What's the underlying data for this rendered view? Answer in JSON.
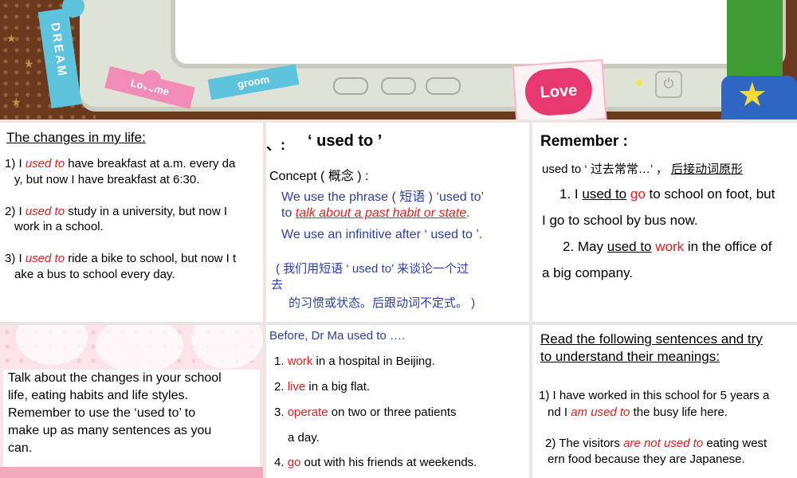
{
  "banner": {
    "sticker_dream": "DREAM",
    "sticker_loveme": "Loveme",
    "sticker_groom": "groom",
    "love_card": "Love"
  },
  "panel1": {
    "title": "The changes in my life:",
    "s1_pre": "1) I ",
    "s1_red": "used to",
    "s1_post": " have breakfast at a.m. every da",
    "s1_line2": "y, but now I have breakfast at 6:30.",
    "s2_pre": "2) I ",
    "s2_red": "used to",
    "s2_post": " study in a university, but now I",
    "s2_line2": "work in a school.",
    "s3_pre": "3) I ",
    "s3_red": "used to",
    "s3_post": " ride a bike to school, but now I t",
    "s3_line2": "ake a bus to school every day."
  },
  "panel2": {
    "heading_prefix": "、:",
    "heading": "‘ used to ’",
    "concept_label": "Concept ( 概念 ) :",
    "line1": "We use the phrase ( 短语 ) ‘used to’",
    "line2_pre": "to ",
    "line2_red": "talk about a past habit or state",
    "line2_post": ".",
    "line3": "We use an infinitive after ‘ used to ’.",
    "cn_line1": "( 我们用短语 ‘ used to’ 来谈论一个过",
    "cn_line2": "去",
    "cn_line3": "的习惯或状态。后跟动词不定式。 )"
  },
  "panel3": {
    "heading": "Remember :",
    "note_pre": "used to ‘ 过去常常…’ ，",
    "note_link": "后接动词原形",
    "s1_pre": "1. I ",
    "s1_ul": "used to",
    "s1_red": "go",
    "s1_post": " to school on foot, but",
    "s1_line2": "I  go to school by bus now.",
    "s2_pre": "2. May ",
    "s2_ul": "used to",
    "s2_red": "work",
    "s2_post": " in the office of",
    "s2_line2": "a big company."
  },
  "panel4": {
    "text": [
      "Talk about the changes in your school",
      "life, eating habits and life styles.",
      "Remember to use the ‘used to’ to",
      "make up as many sentences as you",
      "can."
    ]
  },
  "panel5": {
    "heading": "Before, Dr Ma used to ….",
    "items": [
      {
        "num": "1.",
        "red": "work",
        "rest": " in a hospital in Beijing."
      },
      {
        "num": "2.",
        "red": "live",
        "rest": " in a big flat."
      },
      {
        "num": "3.",
        "red": "operate",
        "rest": " on two or three patients"
      },
      {
        "num": "",
        "red": "",
        "rest": "a day."
      },
      {
        "num": "4.",
        "red": "go",
        "rest": " out with his friends at weekends."
      }
    ]
  },
  "panel6": {
    "heading_line1": "Read the following sentences and try",
    "heading_line2": "to understand their meanings:",
    "s1_line1": "1) I have worked in this school for 5 years a",
    "s1_pre": "nd I ",
    "s1_red": "am used to",
    "s1_post": " the busy life here.",
    "s2_pre": "2) The visitors ",
    "s2_red": "are not used to",
    "s2_post": " eating west",
    "s2_line2": "ern food because they are Japanese."
  },
  "colors": {
    "accent_red": "#e01f1f",
    "accent_blue": "#1a1ad0",
    "banner_brown": "#6b3a1e"
  }
}
